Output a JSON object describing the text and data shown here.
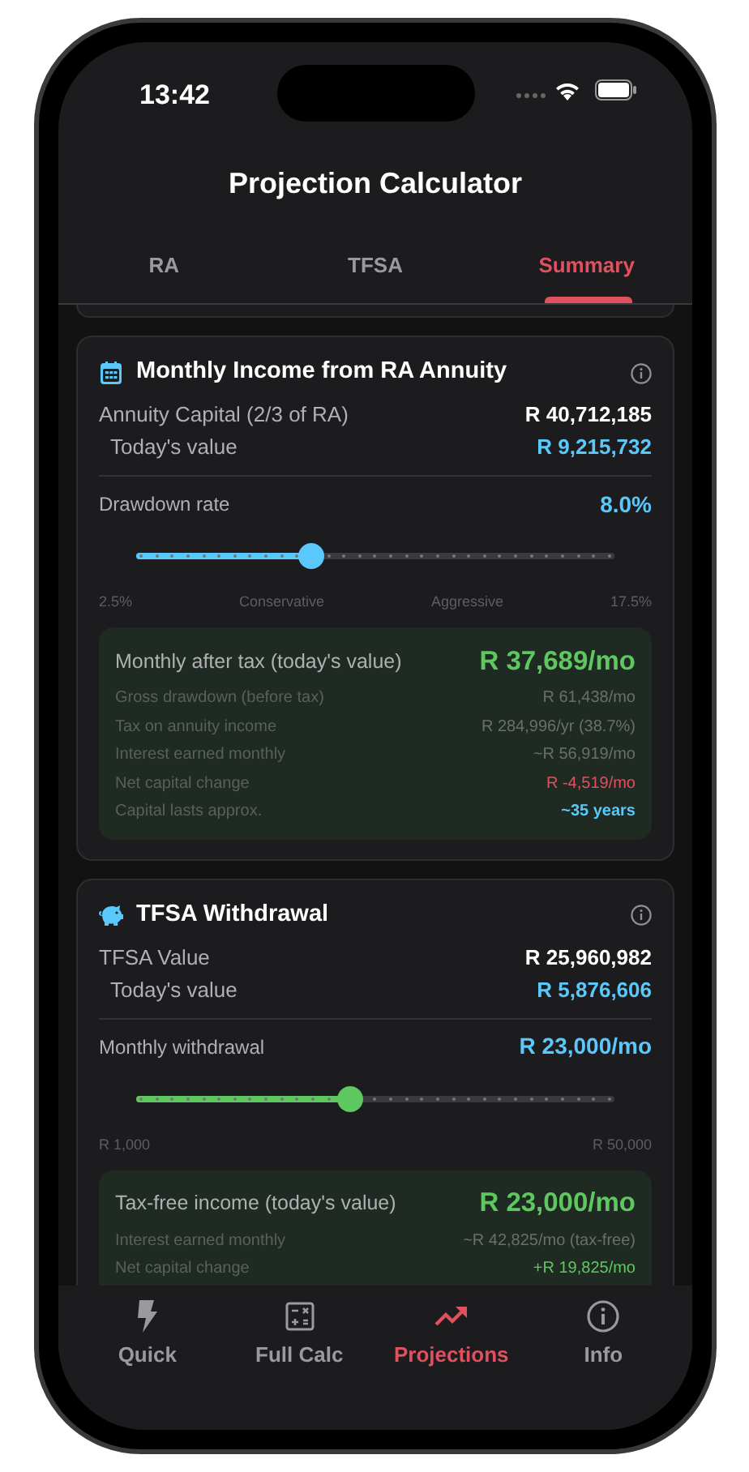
{
  "status_bar": {
    "time": "13:42"
  },
  "title": "Projection Calculator",
  "tabs": [
    {
      "label": "RA",
      "selected": false
    },
    {
      "label": "TFSA",
      "selected": false
    },
    {
      "label": "Summary",
      "selected": true
    }
  ],
  "cards": [
    {
      "kind": "calendar",
      "title": "Monthly Income from RA Annuity",
      "main_row": {
        "label": "Annuity Capital (2/3 of RA)",
        "value": "R 40,712,185"
      },
      "today_row": {
        "label": "Today's value",
        "value": "R 9,215,732"
      },
      "slider": {
        "label": "Drawdown rate",
        "reading": "8.0%",
        "level": 0.367,
        "color": "#5ac8fa",
        "scale_labels": [
          "2.5%",
          "Conservative",
          "Aggressive",
          "17.5%"
        ]
      },
      "result": {
        "label": "Monthly after tax (today's value)",
        "value": "R 37,689/mo"
      },
      "details": [
        {
          "label": "Gross drawdown (before tax)",
          "value": "R 61,438/mo",
          "kind": "plain"
        },
        {
          "label": "Tax on annuity income",
          "value": "R 284,996/yr (38.7%)",
          "kind": "plain"
        },
        {
          "label": "Interest earned monthly",
          "value": "~R 56,919/mo",
          "kind": "plain"
        },
        {
          "label": "Net capital change",
          "value": "R -4,519/mo",
          "kind": "negative"
        },
        {
          "label": "Capital lasts approx.",
          "value": "~35 years",
          "kind": "info"
        }
      ]
    },
    {
      "kind": "piggy",
      "title": "TFSA Withdrawal",
      "main_row": {
        "label": "TFSA Value",
        "value": "R 25,960,982"
      },
      "today_row": {
        "label": "Today's value",
        "value": "R 5,876,606"
      },
      "slider": {
        "label": "Monthly withdrawal",
        "reading": "R 23,000/mo",
        "level": 0.449,
        "color": "#5fc760",
        "scale_labels": [
          "R 1,000",
          "R 50,000"
        ]
      },
      "result": {
        "label": "Tax-free income (today's value)",
        "value": "R 23,000/mo"
      },
      "details": [
        {
          "label": "Interest earned monthly",
          "value": "~R 42,825/mo (tax-free)",
          "kind": "plain"
        },
        {
          "label": "Net capital change",
          "value": "+R 19,825/mo",
          "kind": "positive"
        }
      ]
    }
  ],
  "nav": [
    {
      "label": "Quick",
      "kind": "bolt",
      "selected": false
    },
    {
      "label": "Full Calc",
      "kind": "calculator",
      "selected": false
    },
    {
      "label": "Projections",
      "kind": "trend",
      "selected": true
    },
    {
      "label": "Info",
      "kind": "info",
      "selected": false
    }
  ]
}
